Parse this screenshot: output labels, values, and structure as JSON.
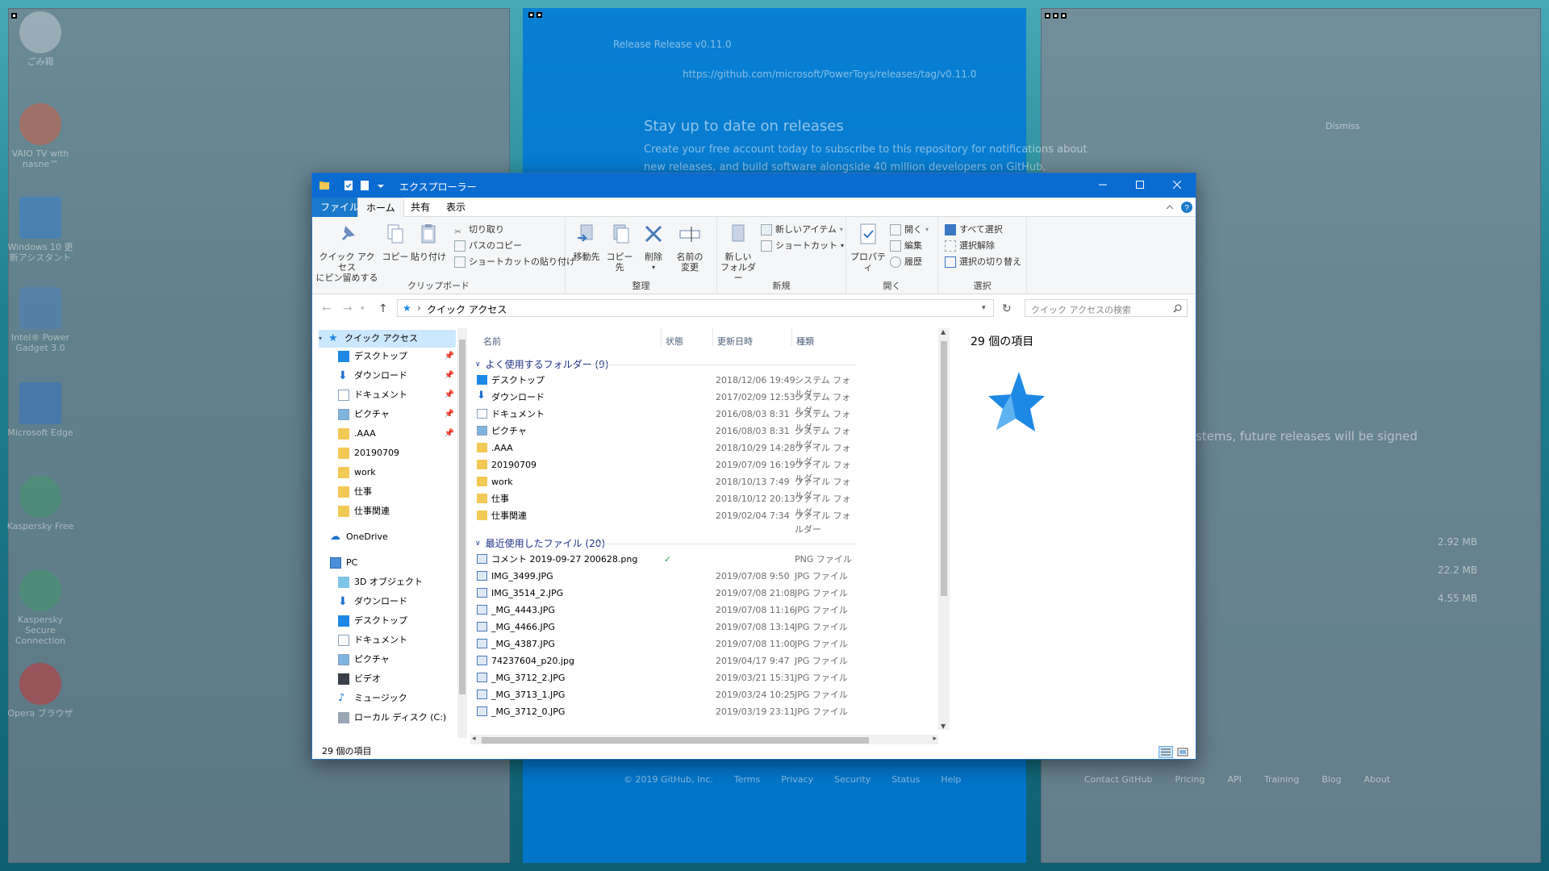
{
  "desktop": {
    "icons": [
      {
        "label": "ごみ箱"
      },
      {
        "label": "VAIO TV with nasne™"
      },
      {
        "label": "Windows 10 更新アシスタント"
      },
      {
        "label": "Intel® Power Gadget 3.0"
      },
      {
        "label": "Microsoft Edge"
      },
      {
        "label": "Kaspersky Free"
      },
      {
        "label": "Kaspersky Secure Connection"
      },
      {
        "label": "Opera ブラウザ"
      }
    ]
  },
  "browser_bg": {
    "tab_title": "Release Release v0.11.0",
    "url": "https://github.com/microsoft/PowerToys/releases/tag/v0.11.0",
    "banner_title": "Stay up to date on releases",
    "banner_text1": "Create your free account today to subscribe to this repository for notifications about",
    "banner_text2": "new releases, and build software alongside 40 million developers on GitHub.",
    "dismiss": "Dismiss",
    "signed_text": "stems, future releases will be signed",
    "sizes": [
      "2.92 MB",
      "22.2 MB",
      "4.55 MB"
    ],
    "footer_left": [
      "© 2019 GitHub, Inc.",
      "Terms",
      "Privacy",
      "Security",
      "Status",
      "Help"
    ],
    "footer_right": [
      "Contact GitHub",
      "Pricing",
      "API",
      "Training",
      "Blog",
      "About"
    ]
  },
  "explorer": {
    "title": "エクスプローラー",
    "tabs": {
      "file": "ファイル",
      "home": "ホーム",
      "share": "共有",
      "view": "表示"
    },
    "ribbon": {
      "pin_quick1": "クイック アクセス",
      "pin_quick2": "にピン留めする",
      "copy": "コピー",
      "paste": "貼り付け",
      "cut": "切り取り",
      "copy_path": "パスのコピー",
      "paste_shortcut": "ショートカットの貼り付け",
      "clipboard": "クリップボード",
      "move_to": "移動先",
      "copy_to": "コピー先",
      "delete": "削除",
      "rename1": "名前の",
      "rename2": "変更",
      "organize": "整理",
      "new_folder1": "新しい",
      "new_folder2": "フォルダー",
      "new_item": "新しいアイテム",
      "shortcut": "ショートカット",
      "new": "新規",
      "properties": "プロパティ",
      "open": "開く",
      "edit": "編集",
      "history": "履歴",
      "open_group": "開く",
      "select_all": "すべて選択",
      "select_none": "選択解除",
      "invert_selection": "選択の切り替え",
      "select_group": "選択"
    },
    "address": {
      "location": "クイック アクセス",
      "search_placeholder": "クイック アクセスの検索"
    },
    "nav": {
      "quick_access": "クイック アクセス",
      "pinned": [
        "デスクトップ",
        "ダウンロード",
        "ドキュメント",
        "ピクチャ",
        ".AAA"
      ],
      "folders": [
        "20190709",
        "work",
        "仕事",
        "仕事関連"
      ],
      "onedrive": "OneDrive",
      "pc": "PC",
      "pc_items": [
        "3D オブジェクト",
        "ダウンロード",
        "デスクトップ",
        "ドキュメント",
        "ピクチャ",
        "ビデオ",
        "ミュージック",
        "ローカル ディスク (C:)"
      ]
    },
    "columns": {
      "name": "名前",
      "status": "状態",
      "modified": "更新日時",
      "type": "種類"
    },
    "group_folders": "よく使用するフォルダー (9)",
    "folders": [
      {
        "name": "デスクトップ",
        "date": "2018/12/06 19:49",
        "type": "システム フォルダー"
      },
      {
        "name": "ダウンロード",
        "date": "2017/02/09 12:53",
        "type": "システム フォルダー"
      },
      {
        "name": "ドキュメント",
        "date": "2016/08/03 8:31",
        "type": "システム フォルダー"
      },
      {
        "name": "ピクチャ",
        "date": "2016/08/03 8:31",
        "type": "システム フォルダー"
      },
      {
        "name": ".AAA",
        "date": "2018/10/29 14:28",
        "type": "ファイル フォルダー"
      },
      {
        "name": "20190709",
        "date": "2019/07/09 16:19",
        "type": "ファイル フォルダー"
      },
      {
        "name": "work",
        "date": "2018/10/13 7:49",
        "type": "ファイル フォルダー"
      },
      {
        "name": "仕事",
        "date": "2018/10/12 20:13",
        "type": "ファイル フォルダー"
      },
      {
        "name": "仕事関連",
        "date": "2019/02/04 7:34",
        "type": "ファイル フォルダー"
      }
    ],
    "group_files": "最近使用したファイル (20)",
    "files": [
      {
        "name": "コメント 2019-09-27 200628.png",
        "date": "",
        "type": "PNG ファイル",
        "status": "✓"
      },
      {
        "name": "IMG_3499.JPG",
        "date": "2019/07/08 9:50",
        "type": "JPG ファイル",
        "status": ""
      },
      {
        "name": "IMG_3514_2.JPG",
        "date": "2019/07/08 21:08",
        "type": "JPG ファイル",
        "status": ""
      },
      {
        "name": "_MG_4443.JPG",
        "date": "2019/07/08 11:16",
        "type": "JPG ファイル",
        "status": ""
      },
      {
        "name": "_MG_4466.JPG",
        "date": "2019/07/08 13:14",
        "type": "JPG ファイル",
        "status": ""
      },
      {
        "name": "_MG_4387.JPG",
        "date": "2019/07/08 11:00",
        "type": "JPG ファイル",
        "status": ""
      },
      {
        "name": "74237604_p20.jpg",
        "date": "2019/04/17 9:47",
        "type": "JPG ファイル",
        "status": ""
      },
      {
        "name": "_MG_3712_2.JPG",
        "date": "2019/03/21 15:31",
        "type": "JPG ファイル",
        "status": ""
      },
      {
        "name": "_MG_3713_1.JPG",
        "date": "2019/03/24 10:25",
        "type": "JPG ファイル",
        "status": ""
      },
      {
        "name": "_MG_3712_0.JPG",
        "date": "2019/03/19 23:11",
        "type": "JPG ファイル",
        "status": ""
      }
    ],
    "preview": {
      "count": "29 個の項目"
    },
    "status": {
      "count": "29 個の項目"
    }
  }
}
